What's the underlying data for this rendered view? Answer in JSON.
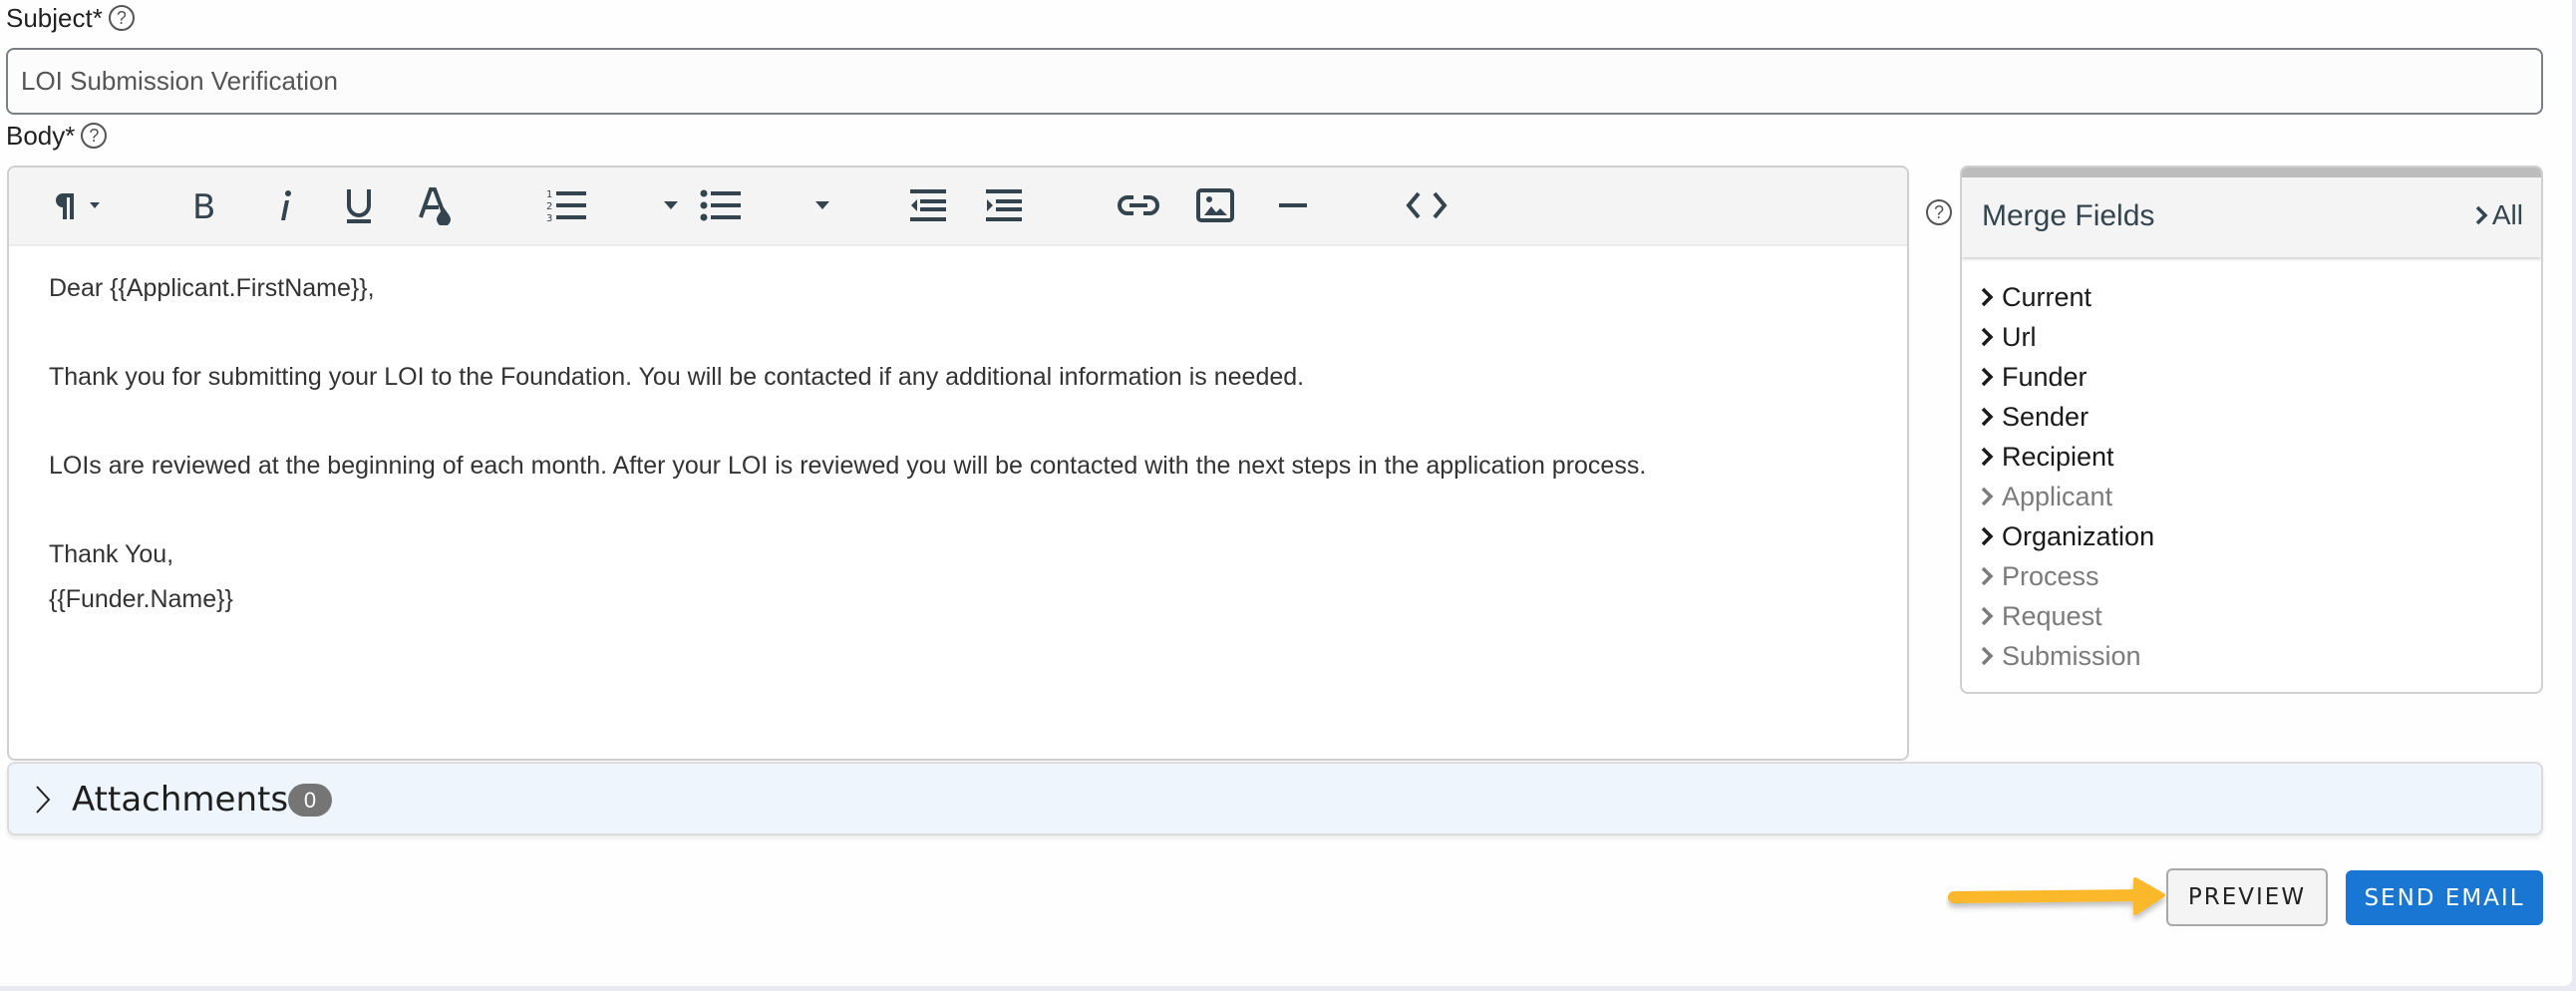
{
  "subject": {
    "label": "Subject*",
    "help": "?",
    "value": "LOI Submission Verification"
  },
  "body": {
    "label": "Body*",
    "help": "?",
    "toolbar": [
      {
        "icon": "paragraph-format-icon",
        "label": "Paragraph format"
      },
      {
        "icon": "bold-icon",
        "label": "Bold"
      },
      {
        "icon": "italic-icon",
        "label": "Italic"
      },
      {
        "icon": "underline-icon",
        "label": "Underline"
      },
      {
        "icon": "text-color-icon",
        "label": "Text color"
      },
      {
        "icon": "ordered-list-icon",
        "label": "Ordered list"
      },
      {
        "icon": "unordered-list-icon",
        "label": "Unordered list"
      },
      {
        "icon": "outdent-icon",
        "label": "Decrease indent"
      },
      {
        "icon": "indent-icon",
        "label": "Increase indent"
      },
      {
        "icon": "link-icon",
        "label": "Insert link"
      },
      {
        "icon": "image-icon",
        "label": "Insert image"
      },
      {
        "icon": "horizontal-rule-icon",
        "label": "Horizontal line"
      },
      {
        "icon": "code-view-icon",
        "label": "Code view"
      }
    ],
    "content": [
      "Dear {{Applicant.FirstName}},",
      "Thank you for submitting your LOI to the Foundation. You will be contacted if any additional information is needed.",
      "LOIs are reviewed at the beginning of each month. After your LOI is reviewed you will be contacted with the next steps in the application process.",
      "Thank You,",
      "{{Funder.Name}}"
    ]
  },
  "merge_fields": {
    "help": "?",
    "title": "Merge Fields",
    "all_label": "All",
    "items": [
      {
        "label": "Current",
        "enabled": true
      },
      {
        "label": "Url",
        "enabled": true
      },
      {
        "label": "Funder",
        "enabled": true
      },
      {
        "label": "Sender",
        "enabled": true
      },
      {
        "label": "Recipient",
        "enabled": true
      },
      {
        "label": "Applicant",
        "enabled": false
      },
      {
        "label": "Organization",
        "enabled": true
      },
      {
        "label": "Process",
        "enabled": false
      },
      {
        "label": "Request",
        "enabled": false
      },
      {
        "label": "Submission",
        "enabled": false
      }
    ]
  },
  "attachments": {
    "label": "Attachments",
    "count": "0"
  },
  "actions": {
    "preview_label": "PREVIEW",
    "send_label": "SEND EMAIL"
  },
  "colors": {
    "primary": "#1976d2",
    "annotation_arrow": "#fbb829",
    "icon": "#34444e",
    "attachments_bg": "#eef5fd",
    "badge": "#757575"
  }
}
